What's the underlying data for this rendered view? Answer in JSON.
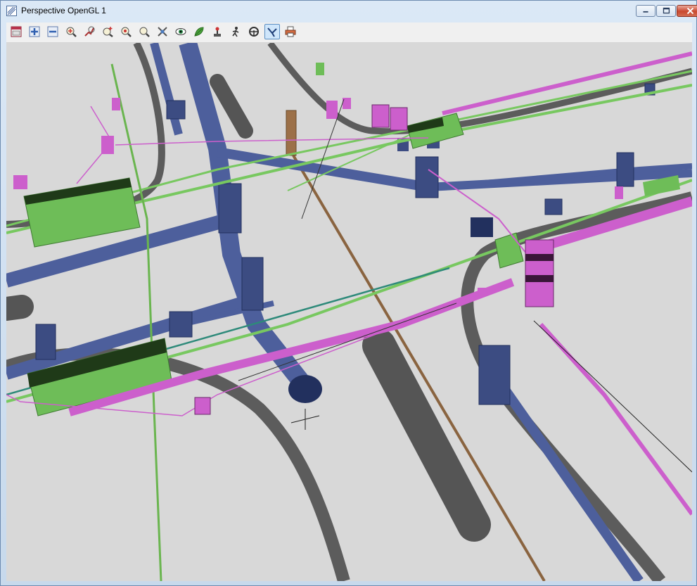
{
  "window": {
    "title": "Perspective OpenGL 1",
    "title_icon": "perspective-view-icon"
  },
  "caption_buttons": {
    "minimize_icon": "minimize-icon",
    "maximize_icon": "maximize-icon",
    "close_icon": "close-icon"
  },
  "toolbar": {
    "buttons": [
      {
        "icon": "window-area-icon",
        "active": false
      },
      {
        "icon": "zoom-in-plus-icon",
        "active": false
      },
      {
        "icon": "zoom-out-minus-icon",
        "active": false
      },
      {
        "icon": "zoom-window-icon",
        "active": false
      },
      {
        "icon": "zoom-fit-icon",
        "active": false
      },
      {
        "icon": "zoom-plus-icon",
        "active": false
      },
      {
        "icon": "zoom-center-icon",
        "active": false
      },
      {
        "icon": "zoom-search-icon",
        "active": false
      },
      {
        "icon": "pan-tool-icon",
        "active": false
      },
      {
        "icon": "eye-view-icon",
        "active": false
      },
      {
        "icon": "render-leaf-icon",
        "active": false
      },
      {
        "icon": "joystick-icon",
        "active": false
      },
      {
        "icon": "walk-person-icon",
        "active": false
      },
      {
        "icon": "steering-wheel-icon",
        "active": false
      },
      {
        "icon": "fly-mode-icon",
        "active": true
      },
      {
        "icon": "print-icon",
        "active": false
      }
    ]
  },
  "colors": {
    "background": "#d8d8d8",
    "pipe_blue": "#4d5f9c",
    "pipe_gray": "#5a5a5a",
    "utility_magenta": "#cc5fcc",
    "utility_green": "#78c860",
    "pipe_brown": "#8a6440",
    "dark_green": "#1f3a18"
  }
}
